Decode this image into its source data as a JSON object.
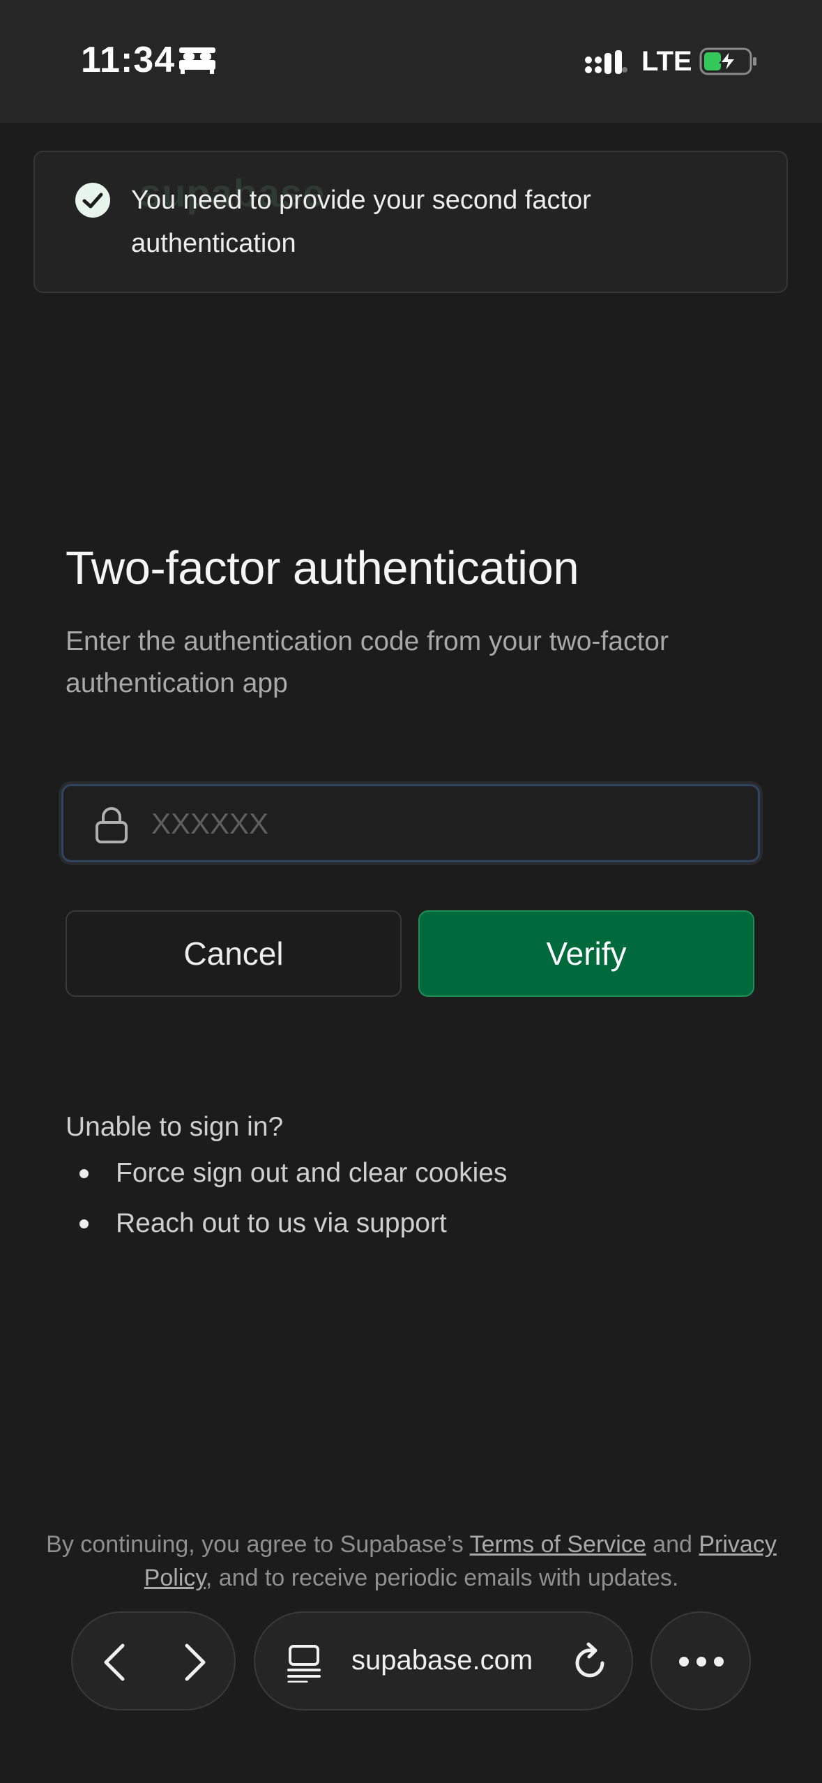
{
  "status_bar": {
    "time": "11:34",
    "network": "LTE",
    "icons": [
      "bed-icon",
      "signal-icon",
      "battery-charging-icon"
    ]
  },
  "toast": {
    "message": "You need to provide your second factor authentication",
    "watermark": "supabase",
    "icon": "check-circle-icon"
  },
  "auth": {
    "title": "Two-factor authentication",
    "subtitle": "Enter the authentication code from your two-factor authentication app",
    "code_placeholder": "XXXXXX",
    "code_value": "",
    "cancel_label": "Cancel",
    "verify_label": "Verify"
  },
  "help": {
    "title": "Unable to sign in?",
    "items": [
      {
        "label": "Force sign out and clear cookies"
      },
      {
        "label": "Reach out to us via support"
      }
    ]
  },
  "legal": {
    "prefix": "By continuing, you agree to Supabase’s ",
    "terms_label": "Terms of Service",
    "and": " and ",
    "privacy_label": "Privacy Policy",
    "suffix": ", and to receive periodic emails with updates."
  },
  "browser": {
    "url": "supabase.com"
  },
  "colors": {
    "background": "#1c1c1c",
    "accent_green": "#006a3c",
    "focus_border": "#2e4460"
  }
}
